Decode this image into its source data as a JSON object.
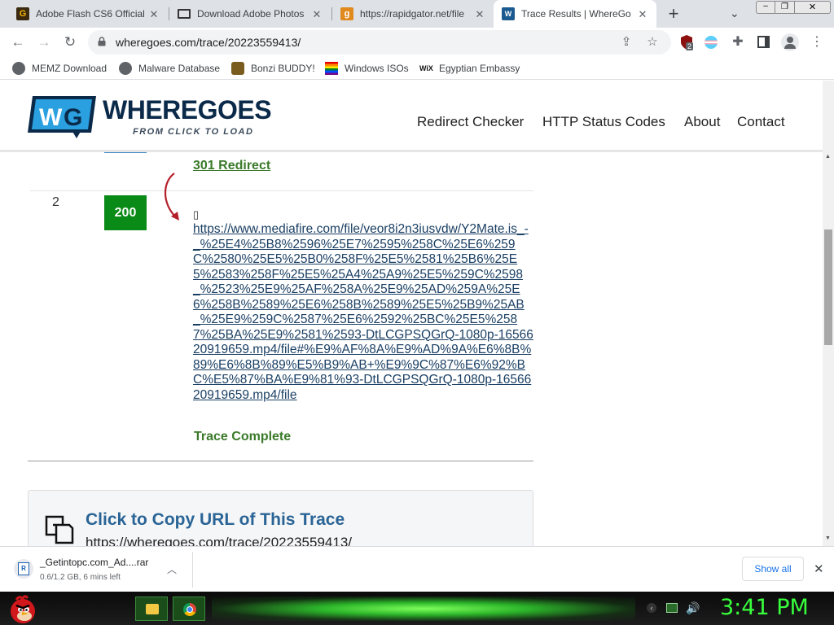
{
  "tabs": [
    {
      "title": "Adobe Flash CS6 Official",
      "favicon": "G"
    },
    {
      "title": "Download Adobe Photos",
      "favicon": "monitor-icon"
    },
    {
      "title": "https://rapidgator.net/file",
      "favicon": "rg"
    },
    {
      "title": "Trace Results | WhereGoe",
      "favicon": "wg"
    }
  ],
  "toolbar": {
    "url": "wheregoes.com/trace/20223559413/",
    "extension_badge": "2"
  },
  "bookmarks": [
    {
      "label": "MEMZ Download"
    },
    {
      "label": "Malware Database"
    },
    {
      "label": "Bonzi BUDDY!"
    },
    {
      "label": "Windows ISOs"
    },
    {
      "label": "Egyptian Embassy"
    }
  ],
  "site": {
    "logo_name": "WHEREGOES",
    "tagline": "FROM CLICK TO LOAD",
    "nav": [
      "Redirect Checker",
      "HTTP Status Codes",
      "About",
      "Contact"
    ]
  },
  "trace": {
    "prev_status_text": "301 Redirect",
    "row_number": "2",
    "status_code": "200",
    "marker_glyph": "▯",
    "url": "https://www.mediafire.com/file/veor8i2n3iusvdw/Y2Mate.is_-_%25E4%25B8%2596%25E7%2595%258C%25E6%259C%2580%25E5%25B0%258F%25E5%2581%25B6%25E5%2583%258F%25E5%25A4%25A9%25E5%259C%2598_%2523%25E9%25AF%258A%25E9%25AD%259A%25E6%258B%2589%25E6%258B%2589%25E5%25B9%25AB_%25E9%259C%2587%25E6%2592%25BC%25E5%2587%25BA%25E9%2581%2593-DtLCGPSQGrQ-1080p-1656620919659.mp4/file#%E9%AF%8A%E9%AD%9A%E6%8B%89%E6%8B%89%E5%B9%AB+%E9%9C%87%E6%92%BC%E5%87%BA%E9%81%93-DtLCGPSQGrQ-1080p-1656620919659.mp4/file",
    "complete_text": "Trace Complete",
    "copy_title": "Click to Copy URL of This Trace",
    "copy_url": "https://wheregoes.com/trace/20223559413/"
  },
  "download": {
    "filename": "_Getintopc.com_Ad....rar",
    "status": "0.6/1.2 GB, 6 mins left",
    "show_all": "Show all"
  },
  "taskbar": {
    "clock": "3:41 PM"
  },
  "colors": {
    "status_200": "#0a8a16",
    "green_text": "#3a7a2a",
    "link": "#1a3f63",
    "clock": "#38ff3c"
  }
}
